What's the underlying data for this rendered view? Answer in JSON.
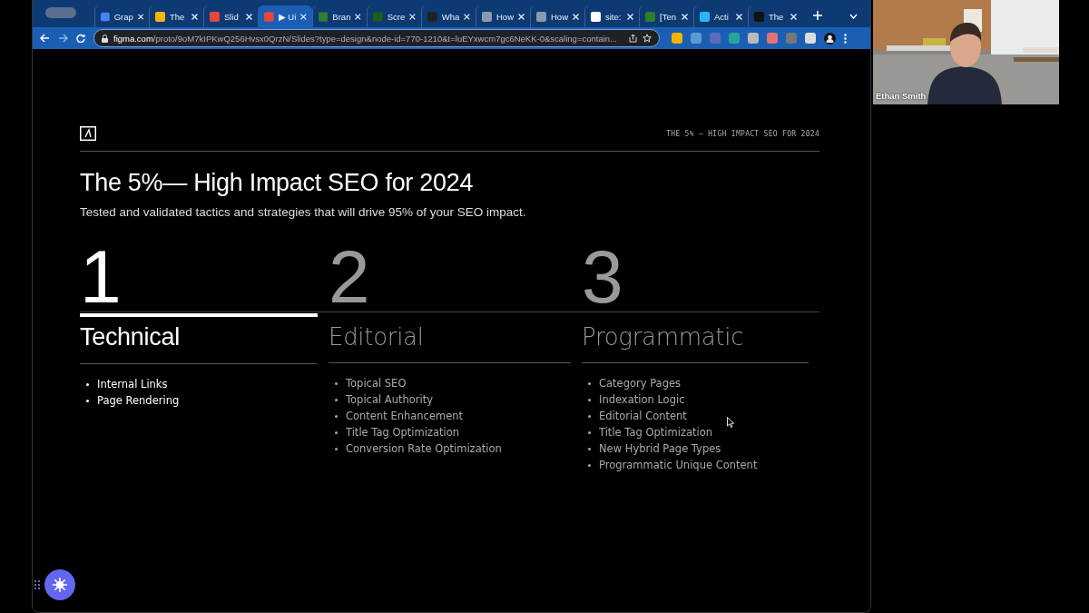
{
  "browser": {
    "tabs": [
      {
        "label": "Grap",
        "selected": false
      },
      {
        "label": "The",
        "selected": false
      },
      {
        "label": "Slid",
        "selected": false
      },
      {
        "label": "▶ Ui",
        "selected": true
      },
      {
        "label": "Bran",
        "selected": false
      },
      {
        "label": "Scre",
        "selected": false
      },
      {
        "label": "Wha",
        "selected": false
      },
      {
        "label": "How",
        "selected": false
      },
      {
        "label": "How",
        "selected": false
      },
      {
        "label": "site:",
        "selected": false
      },
      {
        "label": "[Ten",
        "selected": false
      },
      {
        "label": "Acti",
        "selected": false
      },
      {
        "label": "The",
        "selected": false
      }
    ],
    "address_bar": {
      "host": "figma.com",
      "path": "/proto/9oM7kIPKwQ256Hvsx0QrzN/Slides?type=design&node-id=770-1210&t=luEYxwcm7gc6NeKK-0&scaling=contain..."
    }
  },
  "slide": {
    "header": "THE 5% — HIGH IMPACT SEO FOR 2024",
    "title": "The 5%— High Impact SEO for 2024",
    "subtitle": "Tested and validated tactics and strategies that will drive 95% of your SEO impact.",
    "columns": [
      {
        "number": "1",
        "heading": "Technical",
        "selected": true,
        "items": [
          "Internal Links",
          "Page Rendering"
        ]
      },
      {
        "number": "2",
        "heading": "Editorial",
        "selected": false,
        "items": [
          "Topical SEO",
          "Topical Authority",
          "Content Enhancement",
          "Title Tag Optimization",
          "Conversion Rate Optimization"
        ]
      },
      {
        "number": "3",
        "heading": "Programmatic",
        "selected": false,
        "items": [
          "Category Pages",
          "Indexation Logic",
          "Editorial Content",
          "Title Tag Optimization",
          "New Hybrid Page Types",
          "Programmatic Unique Content"
        ]
      }
    ]
  },
  "video_call": {
    "participant": "Ethan Smith"
  }
}
